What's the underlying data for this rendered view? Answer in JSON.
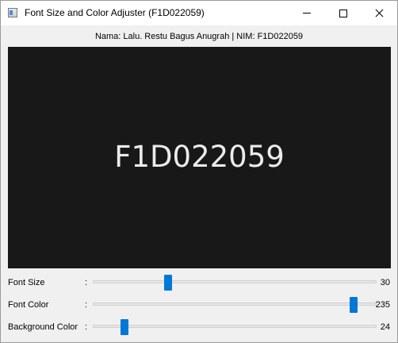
{
  "window": {
    "title": "Font Size and Color Adjuster (F1D022059)"
  },
  "header": {
    "identity": "Nama: Lalu. Restu Bagus Anugrah | NIM: F1D022059"
  },
  "preview": {
    "text": "F1D022059",
    "background_color": "#181818",
    "text_color": "#ebebeb"
  },
  "controls": {
    "font_size": {
      "label": "Font Size",
      "colon": ":",
      "value": "30",
      "fraction": 0.26,
      "accent": "#0078d7"
    },
    "font_color": {
      "label": "Font Color",
      "colon": ":",
      "value": "235",
      "fraction": 0.93,
      "accent": "#0078d7"
    },
    "background_color": {
      "label": "Background Color",
      "colon": ":",
      "value": "24",
      "fraction": 0.1,
      "accent": "#0078d7"
    }
  }
}
